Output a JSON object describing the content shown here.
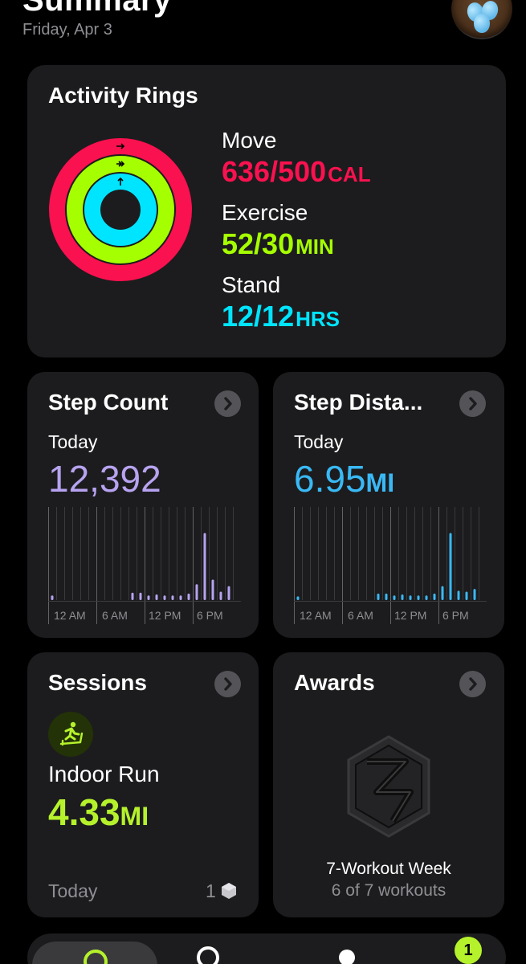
{
  "header": {
    "title": "Summary",
    "date": "Friday, Apr 3"
  },
  "activity": {
    "title": "Activity Rings",
    "move": {
      "label": "Move",
      "value": "636/500",
      "unit": "CAL",
      "color": "#fa114f",
      "progress": 1.27
    },
    "exercise": {
      "label": "Exercise",
      "value": "52/30",
      "unit": "MIN",
      "color": "#a6ff00",
      "progress": 1.73
    },
    "stand": {
      "label": "Stand",
      "value": "12/12",
      "unit": "HRS",
      "color": "#00e5ff",
      "progress": 1.0
    }
  },
  "step_count": {
    "title": "Step Count",
    "period": "Today",
    "value": "12,392",
    "color": "#b7a3f0",
    "axis_labels": [
      "12 AM",
      "6 AM",
      "12 PM",
      "6 PM"
    ],
    "hourly": [
      0.05,
      0,
      0,
      0,
      0,
      0,
      0,
      0,
      0,
      0,
      0.08,
      0.08,
      0.05,
      0.06,
      0.05,
      0.05,
      0.05,
      0.07,
      0.17,
      0.72,
      0.22,
      0.09,
      0.15,
      0
    ]
  },
  "step_distance": {
    "title": "Step Dista...",
    "period": "Today",
    "value": "6.95",
    "unit": "MI",
    "color": "#39b9f5",
    "axis_labels": [
      "12 AM",
      "6 AM",
      "12 PM",
      "6 PM"
    ],
    "hourly": [
      0.04,
      0,
      0,
      0,
      0,
      0,
      0,
      0,
      0,
      0,
      0.07,
      0.07,
      0.05,
      0.06,
      0.05,
      0.05,
      0.05,
      0.07,
      0.15,
      0.72,
      0.1,
      0.09,
      0.12,
      0
    ]
  },
  "sessions": {
    "title": "Sessions",
    "workout": "Indoor Run",
    "value": "4.33",
    "unit": "MI",
    "color": "#b5f22c",
    "period": "Today",
    "count": "1"
  },
  "awards": {
    "title": "Awards",
    "award_name": "7-Workout Week",
    "award_detail": "6 of 7 workouts"
  },
  "tabbar": {
    "badge": "1"
  }
}
